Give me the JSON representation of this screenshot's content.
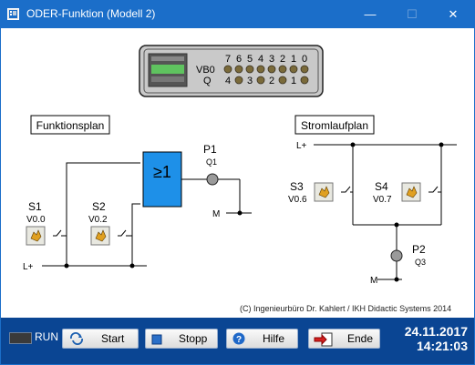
{
  "window": {
    "title": "ODER-Funktion (Modell 2)",
    "minimize_glyph": "—",
    "maximize_glyph": "☐",
    "close_glyph": "✕"
  },
  "plc": {
    "bit_numbers": [
      "7",
      "6",
      "5",
      "4",
      "3",
      "2",
      "1",
      "0"
    ],
    "vb0_label": "VB0",
    "q_label": "Q",
    "q_bits": [
      "4",
      "3",
      "2",
      "1"
    ]
  },
  "funktionsplan": {
    "title": "Funktionsplan",
    "gate_label": "≥1",
    "p1_name": "P1",
    "p1_addr": "Q1",
    "m_label": "M",
    "lplus_label": "L+",
    "s1_name": "S1",
    "s1_addr": "V0.0",
    "s2_name": "S2",
    "s2_addr": "V0.2"
  },
  "stromlaufplan": {
    "title": "Stromlaufplan",
    "lplus_label": "L+",
    "s3_name": "S3",
    "s3_addr": "V0.6",
    "s4_name": "S4",
    "s4_addr": "V0.7",
    "p2_name": "P2",
    "p2_addr": "Q3",
    "m_label": "M"
  },
  "copyright": "(C) Ingenieurbüro Dr. Kahlert / IKH Didactic Systems 2014",
  "toolbar": {
    "run_label": "RUN",
    "start_label": "Start",
    "stopp_label": "Stopp",
    "hilfe_label": "Hilfe",
    "ende_label": "Ende",
    "date": "24.11.2017",
    "time": "14:21:03"
  }
}
